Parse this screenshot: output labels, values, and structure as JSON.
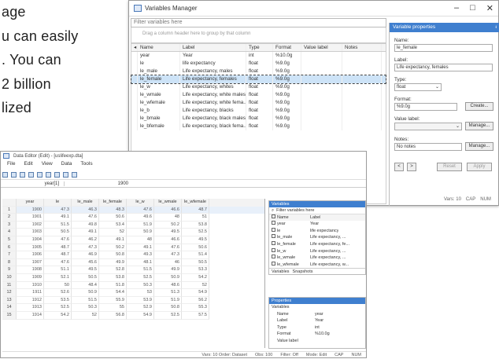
{
  "background_text": {
    "lines": [
      "age",
      "u can easily",
      ". You can",
      " 2 billion",
      "lized"
    ]
  },
  "variables_manager": {
    "title": "Variables Manager",
    "window_controls": [
      "–",
      "□",
      "✕"
    ],
    "filter_placeholder": "Filter variables here",
    "group_hint": "Drag a column header here to group by that column",
    "columns": [
      "Name",
      "Label",
      "Type",
      "Format",
      "Value label",
      "Notes"
    ],
    "rows": [
      {
        "name": "year",
        "label": "Year",
        "type": "int",
        "format": "%10.0g"
      },
      {
        "name": "le",
        "label": "life expectancy",
        "type": "float",
        "format": "%9.0g"
      },
      {
        "name": "le_male",
        "label": "Life expectancy, males",
        "type": "float",
        "format": "%9.0g"
      },
      {
        "name": "le_female",
        "label": "Life expectancy, females",
        "type": "float",
        "format": "%9.0g"
      },
      {
        "name": "le_w",
        "label": "Life expectancy, whites",
        "type": "float",
        "format": "%9.0g"
      },
      {
        "name": "le_wmale",
        "label": "Life expectancy, white males",
        "type": "float",
        "format": "%9.0g"
      },
      {
        "name": "le_wfemale",
        "label": "Life expectancy, white fema...",
        "type": "float",
        "format": "%9.0g"
      },
      {
        "name": "le_b",
        "label": "Life expectancy, blacks",
        "type": "float",
        "format": "%9.0g"
      },
      {
        "name": "le_bmale",
        "label": "Life expectancy, black males",
        "type": "float",
        "format": "%9.0g"
      },
      {
        "name": "le_bfemale",
        "label": "Life expectancy, black fema...",
        "type": "float",
        "format": "%9.0g"
      }
    ],
    "selected_row": 3,
    "properties": {
      "header": "Variable properties",
      "name_label": "Name:",
      "name_value": "le_female",
      "label_label": "Label:",
      "label_value": "Life expectancy, females",
      "type_label": "Type:",
      "type_value": "float",
      "format_label": "Format:",
      "format_value": "%9.0g",
      "create_button": "Create...",
      "value_label_label": "Value label:",
      "manage_button": "Manage...",
      "notes_label": "Notes:",
      "notes_value": "No notes",
      "notes_manage_button": "Manage...",
      "reset_button": "Reset",
      "apply_button": "Apply"
    },
    "status": {
      "left": "Ready",
      "vars": "Vars: 10",
      "caps": "CAP",
      "num": "NUM"
    }
  },
  "data_editor": {
    "title": "Data Editor (Edit) - [uslifeexp.dta]",
    "menu": [
      "File",
      "Edit",
      "View",
      "Data",
      "Tools"
    ],
    "var_label": "year[1]",
    "var_value": "1900",
    "columns": [
      "year",
      "le",
      "le_male",
      "le_female",
      "le_w",
      "le_wmale",
      "le_wfemale"
    ],
    "rows": [
      [
        "1900",
        "47.3",
        "46.3",
        "48.3",
        "47.6",
        "46.6",
        "48.7"
      ],
      [
        "1901",
        "49.1",
        "47.6",
        "50.6",
        "49.6",
        "48",
        "51"
      ],
      [
        "1902",
        "51.5",
        "49.8",
        "53.4",
        "51.9",
        "50.2",
        "53.8"
      ],
      [
        "1903",
        "50.5",
        "49.1",
        "52",
        "50.9",
        "49.5",
        "52.5"
      ],
      [
        "1904",
        "47.6",
        "46.2",
        "49.1",
        "48",
        "46.6",
        "49.5"
      ],
      [
        "1905",
        "48.7",
        "47.3",
        "50.2",
        "49.1",
        "47.6",
        "50.6"
      ],
      [
        "1906",
        "48.7",
        "46.9",
        "50.8",
        "49.3",
        "47.3",
        "51.4"
      ],
      [
        "1907",
        "47.6",
        "45.6",
        "49.9",
        "48.1",
        "46",
        "50.5"
      ],
      [
        "1908",
        "51.1",
        "49.5",
        "52.8",
        "51.5",
        "49.9",
        "53.3"
      ],
      [
        "1909",
        "52.1",
        "50.5",
        "53.8",
        "52.5",
        "50.9",
        "54.2"
      ],
      [
        "1910",
        "50",
        "48.4",
        "51.8",
        "50.3",
        "48.6",
        "52"
      ],
      [
        "1911",
        "52.6",
        "50.9",
        "54.4",
        "53",
        "51.3",
        "54.9"
      ],
      [
        "1912",
        "53.5",
        "51.5",
        "55.9",
        "53.9",
        "51.9",
        "56.2"
      ],
      [
        "1913",
        "52.5",
        "50.3",
        "55",
        "52.9",
        "50.8",
        "55.3"
      ],
      [
        "1914",
        "54.2",
        "52",
        "56.8",
        "54.9",
        "52.5",
        "57.5"
      ]
    ],
    "variables_panel": {
      "header": "Variables",
      "filter": "Filter variables here",
      "col_name": "Name",
      "col_label": "Label",
      "rows": [
        {
          "name": "year",
          "label": "Year"
        },
        {
          "name": "le",
          "label": "life expectancy"
        },
        {
          "name": "le_male",
          "label": "Life expectancy, ..."
        },
        {
          "name": "le_female",
          "label": "Life expectancy, fe..."
        },
        {
          "name": "le_w",
          "label": "Life expectancy, ..."
        },
        {
          "name": "le_wmale",
          "label": "Life expectancy, ..."
        },
        {
          "name": "le_wfemale",
          "label": "Life expectancy, w..."
        }
      ],
      "tab_variables": "Variables",
      "tab_snapshots": "Snapshots"
    },
    "properties_panel": {
      "header": "Properties",
      "group": "Variables",
      "rows": [
        {
          "k": "Name",
          "v": "year"
        },
        {
          "k": "Label",
          "v": "Year"
        },
        {
          "k": "Type",
          "v": "int"
        },
        {
          "k": "Format",
          "v": "%10.0g"
        },
        {
          "k": "Value label",
          "v": ""
        }
      ]
    },
    "status": {
      "view": "Vars: 10 Order: Dataset",
      "obs": "Obs: 100",
      "filter": "Filter: Off",
      "mode": "Mode: Edit",
      "caps": "CAP",
      "num": "NUM"
    }
  }
}
